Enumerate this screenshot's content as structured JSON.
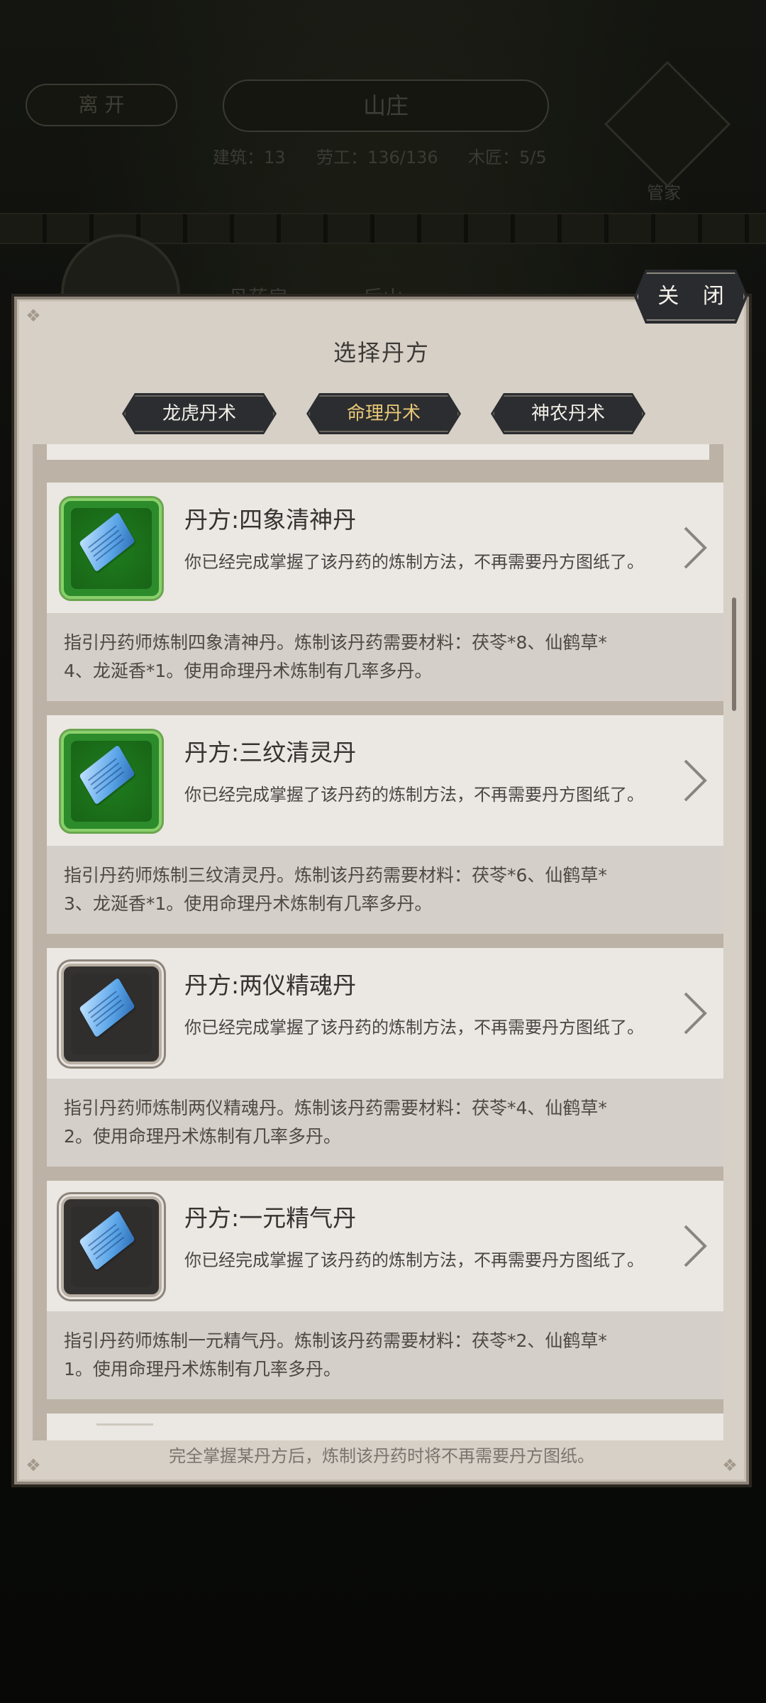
{
  "background": {
    "leave_label": "离 开",
    "village_title": "山庄",
    "stat_building": "建筑：13",
    "stat_labor": "劳工：136/136",
    "stat_carpenter": "木匠：5/5",
    "steward_label": "管家",
    "tab_pharmacy": "丹药房",
    "tab_back": "后山"
  },
  "dialog": {
    "title": "选择丹方",
    "close_label": "关 闭",
    "tabs": [
      {
        "label": "龙虎丹术",
        "active": false
      },
      {
        "label": "命理丹术",
        "active": true
      },
      {
        "label": "神农丹术",
        "active": false
      }
    ],
    "recipes": [
      {
        "name": "丹方:四象清神丹",
        "note": "你已经完成掌握了该丹药的炼制方法，不再需要丹方图纸了。",
        "desc_line1": "指引丹药师炼制四象清神丹。炼制该丹药需要材料：茯苓*8、仙鹤草*",
        "desc_line2": "4、龙涎香*1。使用命理丹术炼制有几率多丹。",
        "icon": "blue-scroll-icon",
        "frame": "green"
      },
      {
        "name": "丹方:三纹清灵丹",
        "note": "你已经完成掌握了该丹药的炼制方法，不再需要丹方图纸了。",
        "desc_line1": "指引丹药师炼制三纹清灵丹。炼制该丹药需要材料：茯苓*6、仙鹤草*",
        "desc_line2": "3、龙涎香*1。使用命理丹术炼制有几率多丹。",
        "icon": "blue-scroll-icon",
        "frame": "green"
      },
      {
        "name": "丹方:两仪精魂丹",
        "note": "你已经完成掌握了该丹药的炼制方法，不再需要丹方图纸了。",
        "desc_line1": "指引丹药师炼制两仪精魂丹。炼制该丹药需要材料：茯苓*4、仙鹤草*",
        "desc_line2": "2。使用命理丹术炼制有几率多丹。",
        "icon": "blue-scroll-icon",
        "frame": "dark"
      },
      {
        "name": "丹方:一元精气丹",
        "note": "你已经完成掌握了该丹药的炼制方法，不再需要丹方图纸了。",
        "desc_line1": "指引丹药师炼制一元精气丹。炼制该丹药需要材料：茯苓*2、仙鹤草*",
        "desc_line2": "1。使用命理丹术炼制有几率多丹。",
        "icon": "blue-scroll-icon",
        "frame": "dark"
      }
    ],
    "footer": "完全掌握某丹方后，炼制该丹药时将不再需要丹方图纸。"
  }
}
